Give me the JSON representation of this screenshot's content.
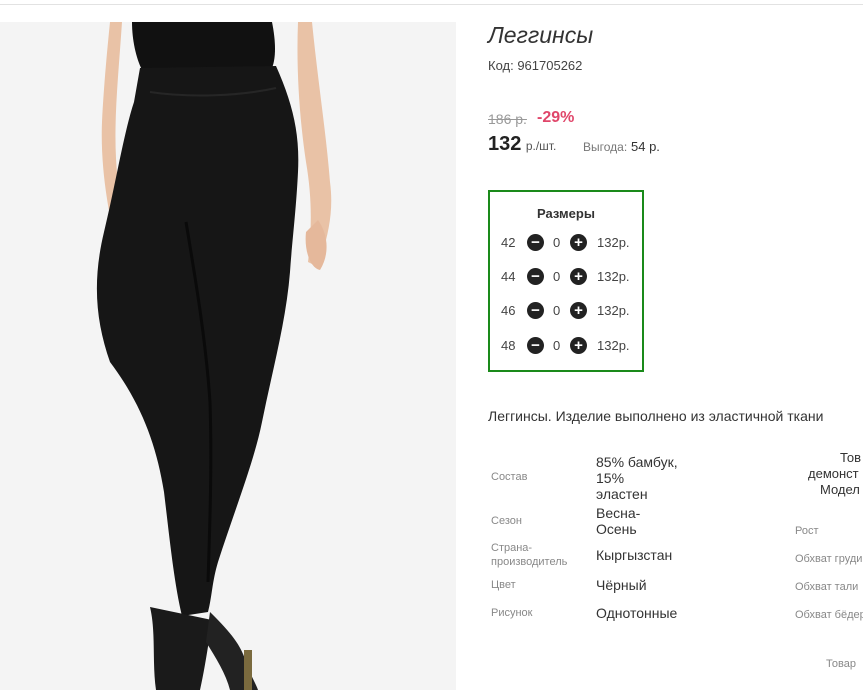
{
  "product": {
    "title": "Леггинсы",
    "code": "Код: 961705262",
    "old_price": "186 р.",
    "discount": "-29%",
    "price": "132",
    "price_unit": "р./шт.",
    "saving_label": "Выгода:",
    "saving_value": "54 р.",
    "description": "Леггинсы. Изделие выполнено из эластичной ткани"
  },
  "sizes": {
    "title": "Размеры",
    "rows": [
      {
        "size": "42",
        "qty": "0",
        "price": "132р."
      },
      {
        "size": "44",
        "qty": "0",
        "price": "132р."
      },
      {
        "size": "46",
        "qty": "0",
        "price": "132р."
      },
      {
        "size": "48",
        "qty": "0",
        "price": "132р."
      }
    ],
    "minus_icon": "minus-circle-icon",
    "plus_icon": "plus-circle-icon"
  },
  "attributes": [
    {
      "label": "Состав",
      "value": "85% бамбук,\n15%\nэластен"
    },
    {
      "label": "Сезон",
      "value": "Весна-\nОсень"
    },
    {
      "label": "Страна-\nпроизводитель",
      "value": "Кыргызстан"
    },
    {
      "label": "Цвет",
      "value": "Чёрный"
    },
    {
      "label": "Рисунок",
      "value": "Однотонные"
    }
  ],
  "model_info": {
    "heading_lines": [
      "Тов",
      "демонст",
      "Модел"
    ],
    "params": [
      "Рост",
      "Обхват груди",
      "Обхват тали",
      "Обхват бёдер"
    ],
    "footer": "Товар"
  },
  "colors": {
    "discount": "#e0466a",
    "sizes_border": "#1a8a1a",
    "button": "#222222"
  }
}
